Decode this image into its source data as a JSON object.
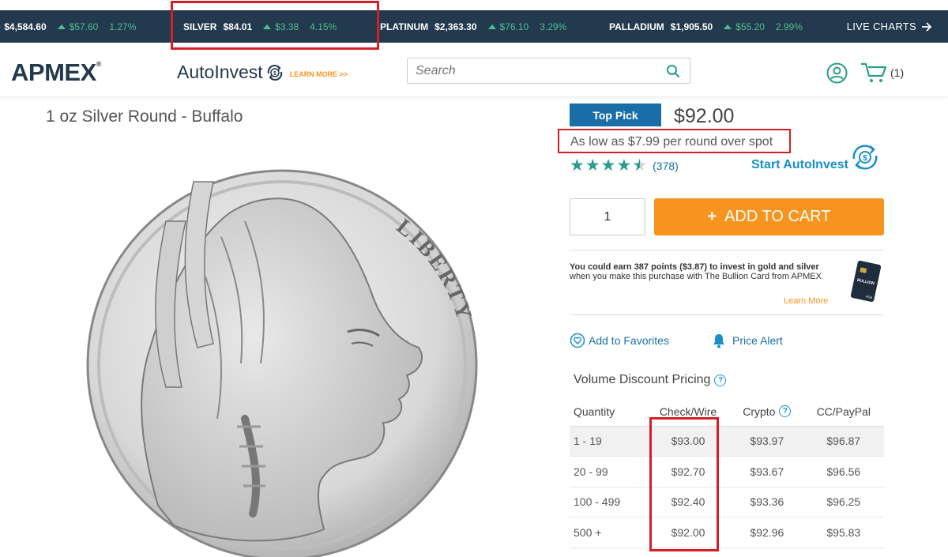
{
  "ticker": {
    "items": [
      {
        "name": "",
        "price": "$4,584.60",
        "change": "$57.60",
        "pct": "1.27%"
      },
      {
        "name": "SILVER",
        "price": "$84.01",
        "change": "$3.38",
        "pct": "4.15%"
      },
      {
        "name": "PLATINUM",
        "price": "$2,363.30",
        "change": "$76.10",
        "pct": "3.29%"
      },
      {
        "name": "PALLADIUM",
        "price": "$1,905.50",
        "change": "$55.20",
        "pct": "2.99%"
      }
    ],
    "live_charts": "LIVE CHARTS",
    "change_color": "#4fbf8e",
    "bg_color": "#23394d"
  },
  "header": {
    "logo": "APMEX",
    "logo_mark": "®",
    "autoinvest": "AutoInvest",
    "learn_more": "LEARN MORE >>",
    "search_placeholder": "Search",
    "cart_count": "(1)"
  },
  "product": {
    "title": "1 oz Silver Round - Buffalo",
    "coin_text": "LIBERTY",
    "badge": "Top Pick",
    "price": "$92.00",
    "low_as": "As low as $7.99 per round over spot",
    "rating": 4.5,
    "review_count": "(378)",
    "start_autoinvest": "Start AutoInvest",
    "quantity": "1",
    "add_to_cart": "ADD TO CART",
    "add_plus": "+",
    "earn_bold": "You could earn 387 points ($3.87) to invest in gold and silver",
    "earn_rest": " when you make this purchase with The Bullion Card from APMEX",
    "learn_more": "Learn More",
    "card_label": "BULLION",
    "card_brand": "VISA",
    "add_favorites": "Add to Favorites",
    "price_alert": "Price Alert"
  },
  "pricing": {
    "title": "Volume Discount Pricing",
    "headers": [
      "Quantity",
      "Check/Wire",
      "Crypto",
      "CC/PayPal"
    ],
    "rows": [
      [
        "1 - 19",
        "$93.00",
        "$93.97",
        "$96.87"
      ],
      [
        "20 - 99",
        "$92.70",
        "$93.67",
        "$96.56"
      ],
      [
        "100 - 499",
        "$92.40",
        "$93.36",
        "$96.25"
      ],
      [
        "500 +",
        "$92.00",
        "$92.96",
        "$95.83"
      ]
    ]
  },
  "colors": {
    "accent_orange": "#f7941d",
    "link_blue": "#1a6ea8",
    "teal": "#2a9d8f",
    "highlight_red": "#d32027"
  }
}
